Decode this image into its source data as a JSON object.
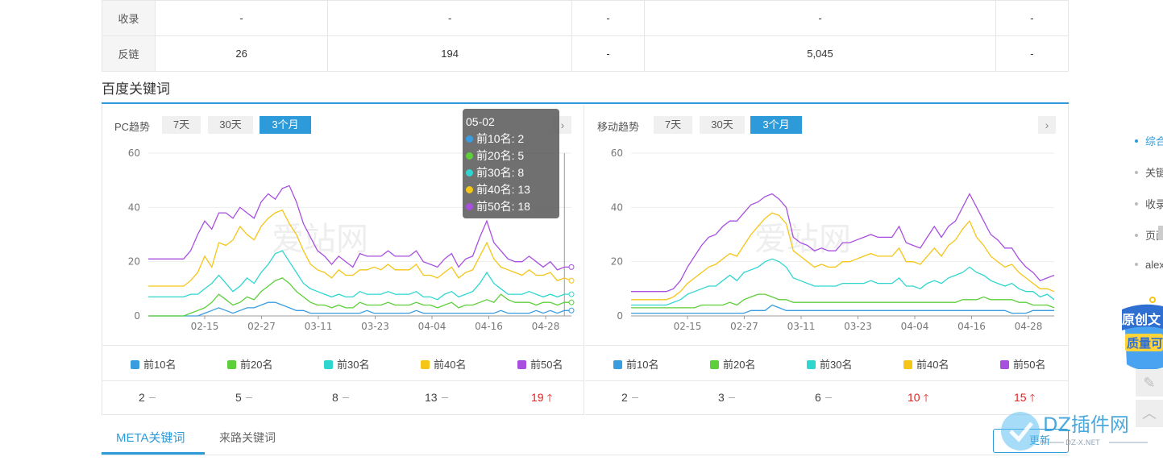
{
  "top_table": {
    "rows": [
      {
        "label": "收录",
        "cells": [
          "-",
          "-",
          "-",
          "-",
          "-"
        ]
      },
      {
        "label": "反链",
        "cells": [
          "26",
          "194",
          "-",
          "5,045",
          "-"
        ]
      }
    ]
  },
  "section_title": "百度关键词",
  "pc": {
    "title": "PC趋势",
    "buttons": [
      "7天",
      "30天",
      "3个月"
    ],
    "active_button": "3个月",
    "arrow": "›",
    "legend": [
      "前10名",
      "前20名",
      "前30名",
      "前40名",
      "前50名"
    ],
    "values": [
      {
        "value": "2",
        "trend": "flat"
      },
      {
        "value": "5",
        "trend": "flat"
      },
      {
        "value": "8",
        "trend": "flat"
      },
      {
        "value": "13",
        "trend": "flat"
      },
      {
        "value": "19",
        "trend": "up"
      }
    ],
    "tooltip": {
      "date": "05-02",
      "lines": [
        "前10名: 2",
        "前20名: 5",
        "前30名: 8",
        "前40名: 13",
        "前50名: 18"
      ]
    },
    "watermark": "爱站网"
  },
  "mobile": {
    "title": "移动趋势",
    "buttons": [
      "7天",
      "30天",
      "3个月"
    ],
    "active_button": "3个月",
    "arrow": "›",
    "legend": [
      "前10名",
      "前20名",
      "前30名",
      "前40名",
      "前50名"
    ],
    "values": [
      {
        "value": "2",
        "trend": "flat"
      },
      {
        "value": "3",
        "trend": "flat"
      },
      {
        "value": "6",
        "trend": "flat"
      },
      {
        "value": "10",
        "trend": "up"
      },
      {
        "value": "15",
        "trend": "up"
      }
    ],
    "watermark": "爱站网"
  },
  "colors": {
    "top10": "#3a9de0",
    "top20": "#5ccf3a",
    "top30": "#2fd6d0",
    "top40": "#f5c518",
    "top50": "#a84fe0",
    "accent": "#2d9bd9",
    "up": "#e02020"
  },
  "chart_data": [
    {
      "type": "line",
      "x_ticks": [
        "02-15",
        "02-27",
        "03-11",
        "03-23",
        "04-04",
        "04-16",
        "04-28"
      ],
      "ylim": [
        0,
        60
      ],
      "y_ticks": [
        0,
        20,
        40,
        60
      ],
      "grid": true,
      "series": [
        {
          "name": "前10名",
          "values": [
            0,
            0,
            0,
            0,
            0,
            0,
            0,
            0,
            1,
            2,
            3,
            2,
            1,
            2,
            3,
            3,
            4,
            5,
            5,
            4,
            3,
            2,
            2,
            1,
            1,
            1,
            1,
            1,
            1,
            1,
            1,
            2,
            1,
            1,
            1,
            1,
            1,
            1,
            2,
            1,
            1,
            1,
            1,
            1,
            1,
            1,
            1,
            1,
            1,
            1,
            2,
            1,
            1,
            1,
            1,
            2,
            1,
            2,
            1,
            2,
            2
          ]
        },
        {
          "name": "前20名",
          "values": [
            0,
            0,
            0,
            0,
            0,
            0,
            1,
            2,
            3,
            5,
            8,
            6,
            4,
            5,
            7,
            6,
            9,
            11,
            13,
            14,
            12,
            9,
            7,
            5,
            4,
            4,
            3,
            4,
            3,
            3,
            5,
            4,
            4,
            4,
            5,
            4,
            4,
            4,
            5,
            4,
            4,
            3,
            4,
            5,
            3,
            4,
            4,
            5,
            6,
            5,
            8,
            6,
            5,
            5,
            5,
            4,
            5,
            5,
            4,
            5,
            5
          ]
        },
        {
          "name": "前30名",
          "values": [
            7,
            7,
            7,
            7,
            7,
            7,
            8,
            8,
            10,
            12,
            15,
            12,
            9,
            11,
            14,
            12,
            16,
            19,
            23,
            24,
            20,
            16,
            12,
            10,
            9,
            8,
            7,
            8,
            7,
            7,
            9,
            8,
            8,
            8,
            9,
            8,
            8,
            8,
            9,
            7,
            7,
            6,
            8,
            9,
            7,
            8,
            9,
            12,
            16,
            12,
            10,
            8,
            8,
            8,
            9,
            8,
            7,
            8,
            7,
            8,
            8
          ]
        },
        {
          "name": "前40名",
          "values": [
            11,
            11,
            11,
            11,
            11,
            11,
            13,
            16,
            22,
            18,
            27,
            26,
            28,
            33,
            30,
            28,
            33,
            36,
            38,
            39,
            34,
            30,
            24,
            19,
            17,
            16,
            14,
            17,
            15,
            15,
            17,
            17,
            18,
            17,
            19,
            17,
            17,
            17,
            19,
            15,
            15,
            14,
            16,
            18,
            14,
            16,
            17,
            22,
            27,
            21,
            18,
            17,
            16,
            15,
            17,
            15,
            15,
            16,
            13,
            14,
            13
          ]
        },
        {
          "name": "前50名",
          "values": [
            21,
            21,
            21,
            21,
            21,
            21,
            24,
            30,
            35,
            32,
            38,
            38,
            36,
            40,
            38,
            36,
            42,
            45,
            43,
            47,
            48,
            42,
            34,
            29,
            24,
            22,
            19,
            22,
            20,
            18,
            23,
            22,
            22,
            22,
            24,
            22,
            22,
            22,
            24,
            20,
            19,
            18,
            21,
            23,
            18,
            21,
            22,
            29,
            35,
            27,
            24,
            21,
            20,
            20,
            22,
            20,
            18,
            20,
            17,
            18,
            18
          ]
        }
      ],
      "annotations": [
        {
          "x": "05-02",
          "text": "tooltip"
        }
      ]
    },
    {
      "type": "line",
      "x_ticks": [
        "02-15",
        "02-27",
        "03-11",
        "03-23",
        "04-04",
        "04-16",
        "04-28"
      ],
      "ylim": [
        0,
        60
      ],
      "y_ticks": [
        0,
        20,
        40,
        60
      ],
      "grid": true,
      "series": [
        {
          "name": "前10名",
          "values": [
            1,
            1,
            1,
            1,
            1,
            1,
            1,
            1,
            1,
            1,
            1,
            1,
            1,
            1,
            1,
            1,
            1,
            2,
            2,
            2,
            4,
            3,
            2,
            2,
            2,
            2,
            2,
            2,
            2,
            2,
            2,
            2,
            2,
            2,
            2,
            2,
            2,
            2,
            2,
            2,
            2,
            2,
            2,
            2,
            2,
            2,
            2,
            2,
            2,
            2,
            2,
            2,
            2,
            2,
            1,
            1,
            1,
            2,
            2,
            2,
            2
          ]
        },
        {
          "name": "前20名",
          "values": [
            3,
            3,
            3,
            3,
            3,
            3,
            3,
            3,
            3,
            3,
            4,
            4,
            4,
            4,
            5,
            4,
            6,
            7,
            8,
            8,
            7,
            6,
            6,
            5,
            5,
            5,
            5,
            5,
            5,
            5,
            5,
            5,
            5,
            5,
            5,
            5,
            5,
            5,
            5,
            5,
            5,
            5,
            5,
            5,
            5,
            5,
            5,
            6,
            6,
            6,
            7,
            6,
            6,
            6,
            6,
            5,
            5,
            4,
            4,
            4,
            3
          ]
        },
        {
          "name": "前30名",
          "values": [
            4,
            4,
            4,
            4,
            4,
            4,
            5,
            6,
            8,
            9,
            10,
            11,
            11,
            13,
            15,
            13,
            16,
            17,
            18,
            20,
            21,
            20,
            18,
            14,
            13,
            12,
            11,
            11,
            11,
            11,
            12,
            12,
            12,
            12,
            13,
            12,
            12,
            12,
            14,
            11,
            11,
            10,
            12,
            13,
            12,
            14,
            15,
            16,
            18,
            16,
            15,
            13,
            12,
            11,
            12,
            10,
            9,
            9,
            7,
            8,
            6
          ]
        },
        {
          "name": "前40名",
          "values": [
            6,
            6,
            6,
            6,
            6,
            6,
            7,
            9,
            12,
            14,
            16,
            18,
            19,
            21,
            23,
            22,
            26,
            30,
            33,
            36,
            38,
            37,
            34,
            24,
            22,
            20,
            18,
            19,
            18,
            18,
            20,
            20,
            21,
            22,
            23,
            22,
            22,
            22,
            25,
            20,
            20,
            19,
            22,
            25,
            22,
            26,
            28,
            32,
            35,
            29,
            26,
            22,
            20,
            18,
            19,
            16,
            14,
            12,
            10,
            10,
            9
          ]
        },
        {
          "name": "前50名",
          "values": [
            9,
            9,
            9,
            9,
            9,
            9,
            10,
            13,
            18,
            22,
            26,
            29,
            30,
            33,
            35,
            35,
            38,
            41,
            42,
            44,
            45,
            43,
            40,
            29,
            27,
            26,
            24,
            25,
            24,
            24,
            27,
            27,
            28,
            29,
            30,
            29,
            29,
            29,
            33,
            27,
            26,
            25,
            29,
            33,
            29,
            33,
            35,
            40,
            45,
            40,
            35,
            30,
            28,
            25,
            25,
            21,
            18,
            16,
            13,
            14,
            15
          ]
        }
      ]
    }
  ],
  "tabs": [
    "META关键词",
    "来路关键词"
  ],
  "update_button": "更新",
  "side_nav": [
    "综合",
    "关键",
    "收录",
    "页面",
    "alexa"
  ],
  "float_badge": [
    "原创文",
    "质量可"
  ],
  "site_watermark": {
    "main": "DZ插件网",
    "sub": "DZ-X.NET"
  }
}
